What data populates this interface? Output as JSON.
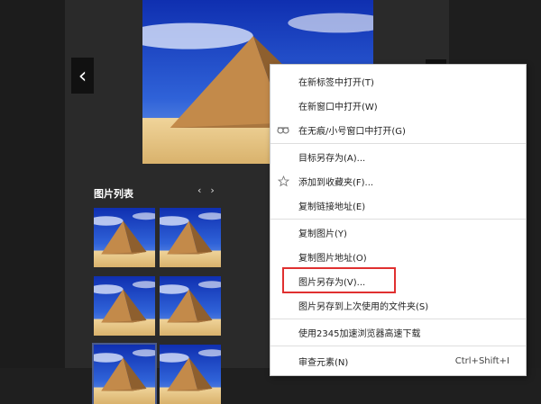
{
  "viewer": {
    "list_title": "图片列表",
    "list_prev": "‹",
    "list_next": "›",
    "prev_glyph": "‹"
  },
  "context_menu": {
    "items": [
      {
        "label": "在新标签中打开(T)",
        "icon": ""
      },
      {
        "label": "在新窗口中打开(W)",
        "icon": ""
      },
      {
        "label": "在无痕/小号窗口中打开(G)",
        "icon": "incognito-icon"
      },
      {
        "label": "目标另存为(A)...",
        "icon": ""
      },
      {
        "label": "添加到收藏夹(F)...",
        "icon": "star-icon"
      },
      {
        "label": "复制链接地址(E)",
        "icon": ""
      },
      {
        "label": "复制图片(Y)",
        "icon": ""
      },
      {
        "label": "复制图片地址(O)",
        "icon": ""
      },
      {
        "label": "图片另存为(V)...",
        "icon": ""
      },
      {
        "label": "图片另存到上次使用的文件夹(S)",
        "icon": ""
      },
      {
        "label": "使用2345加速浏览器高速下载",
        "icon": ""
      },
      {
        "label": "审查元素(N)",
        "shortcut": "Ctrl+Shift+I",
        "icon": ""
      }
    ]
  },
  "colors": {
    "highlight_border": "#e03030",
    "sky": "#1f47c8",
    "sand": "#e8c987",
    "pyramid": "#b07a3e"
  }
}
